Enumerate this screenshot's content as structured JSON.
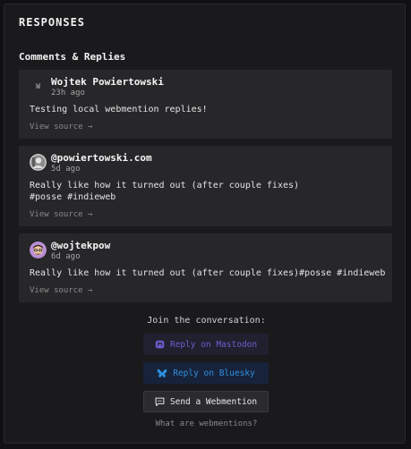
{
  "section": {
    "title": "RESPONSES",
    "subtitle": "Comments & Replies"
  },
  "comments": [
    {
      "avatar_letter": "W",
      "author": "Wojtek Powiertowski",
      "time": "23h ago",
      "content": "Testing local webmention replies!",
      "source_link": "View source →"
    },
    {
      "avatar_icon": "profile-photo-icon",
      "author": "@powiertowski.com",
      "time": "5d ago",
      "content": "Really like how it turned out (after couple fixes)\n#posse #indieweb",
      "source_link": "View source →"
    },
    {
      "avatar_icon": "cartoon-avatar-icon",
      "author": "@wojtekpow",
      "time": "6d ago",
      "content": "Really like how it turned out (after couple fixes)#posse #indieweb",
      "source_link": "View source →"
    }
  ],
  "cta": {
    "join_text": "Join the conversation:",
    "mastodon_label": "Reply on Mastodon",
    "bluesky_label": "Reply on Bluesky",
    "webmention_label": "Send a Webmention",
    "what_link": "What are webmentions?"
  },
  "colors": {
    "mastodon": "#6d5fd0",
    "bluesky": "#2f8fe0",
    "card_bg": "#27272a",
    "page_bg": "#111114"
  }
}
